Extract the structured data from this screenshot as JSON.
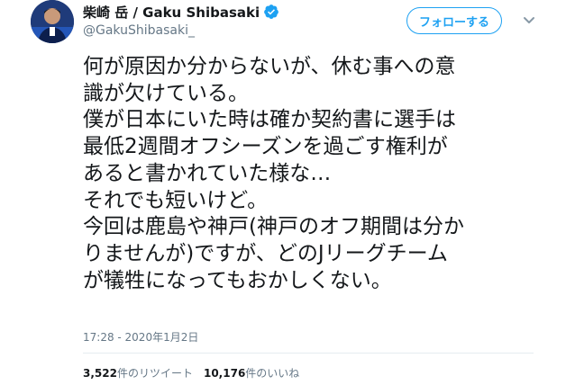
{
  "profile": {
    "display_name": "柴崎 岳 / Gaku Shibasaki",
    "handle": "@GakuShibasaki_",
    "avatar_icon": "person-avatar-icon",
    "verified_icon": "verified-badge-icon"
  },
  "follow_button": {
    "label": "フォローする"
  },
  "menu_icon": "chevron-down-icon",
  "tweet": {
    "text": "何が原因か分からないが、休む事への意\n識が欠けている。\n僕が日本にいた時は確か契約書に選手は\n最低2週間オフシーズンを過ごす権利が\nあると書かれていた様な…\nそれでも短いけど。\n今回は鹿島や神戸(神戸のオフ期間は分か\nりませんが)ですが、どのJリーグチーム\nが犠牲になってもおかしくない。",
    "timestamp": "17:28 - 2020年1月2日"
  },
  "stats": {
    "retweet_count": "3,522",
    "retweet_label": "件のリツイート",
    "like_count": "10,176",
    "like_label": "件のいいね"
  },
  "colors": {
    "accent": "#1da1f2",
    "text": "#14171a",
    "muted": "#657786"
  }
}
